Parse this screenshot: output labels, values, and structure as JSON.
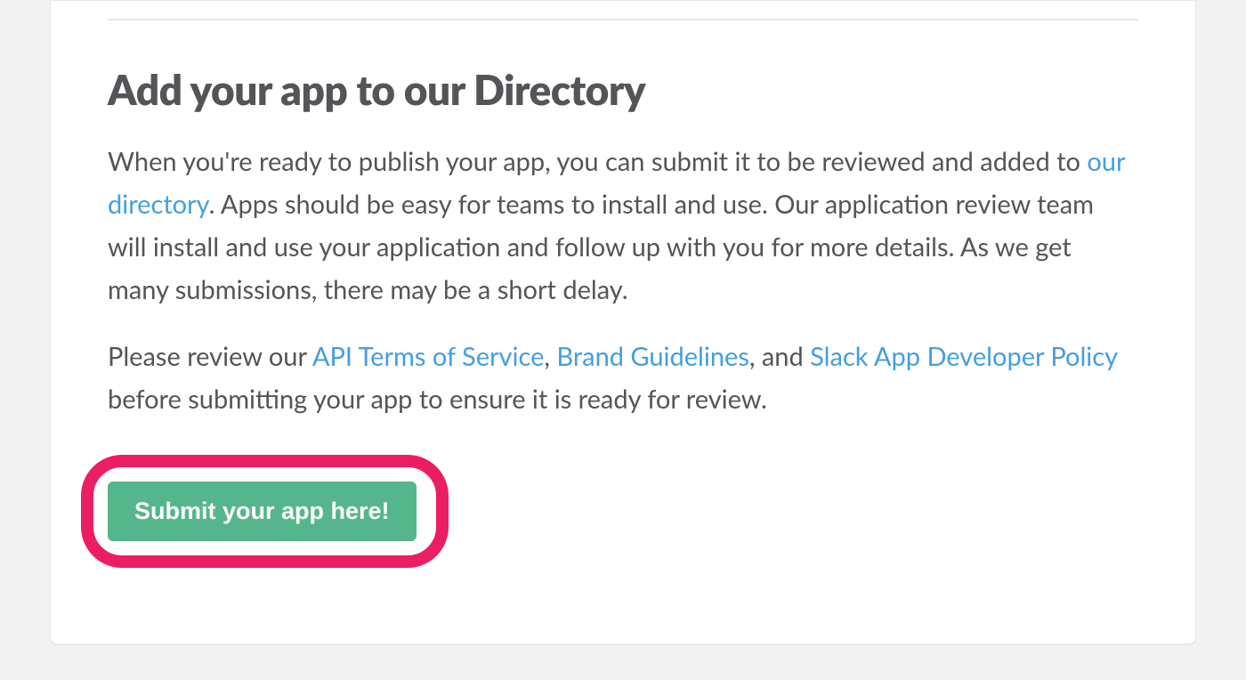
{
  "heading": "Add your app to our Directory",
  "para1": {
    "before_link": "When you're ready to publish your app, you can submit it to be reviewed and added to ",
    "link_directory": "our directory",
    "after_link": ". Apps should be easy for teams to install and use. Our application review team will install and use your application and follow up with you for more details. As we get many submissions, there may be a short delay."
  },
  "para2": {
    "prefix": "Please review our ",
    "link_api_tos": "API Terms of Service",
    "sep1": ", ",
    "link_brand": "Brand Guidelines",
    "sep2": ", and ",
    "link_policy": "Slack App Developer Policy",
    "suffix": " before submitting your app to ensure it is ready for review."
  },
  "cta_label": "Submit your app here!"
}
